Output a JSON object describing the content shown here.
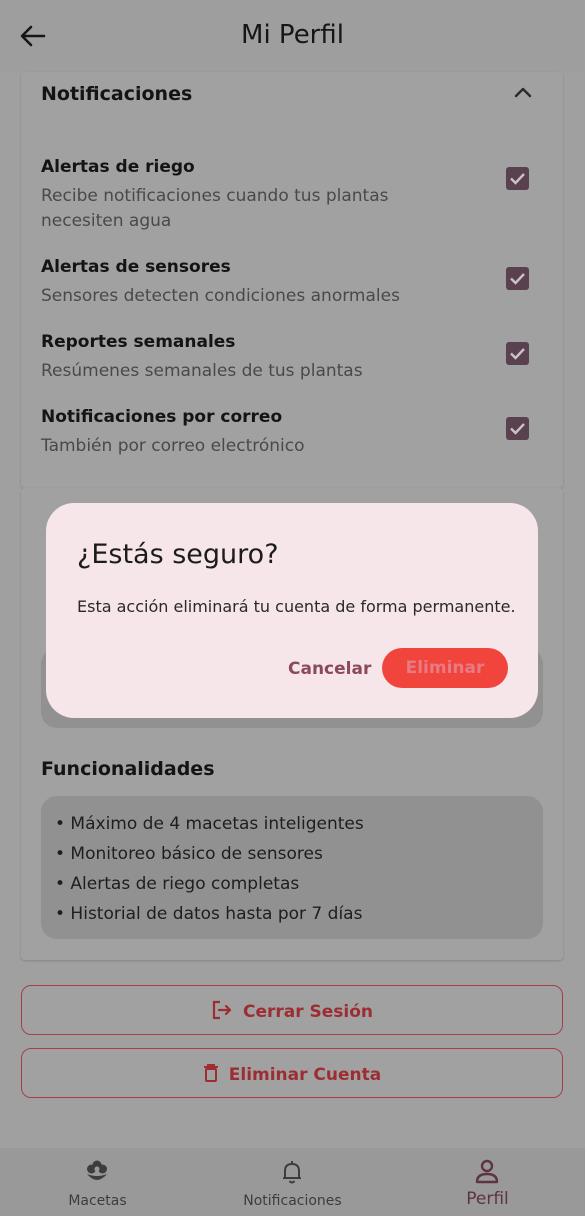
{
  "app_bar": {
    "title": "Mi Perfil"
  },
  "notifications": {
    "title": "Notificaciones",
    "items": [
      {
        "title": "Alertas de riego",
        "subtitle": "Recibe notificaciones cuando tus plantas necesiten agua",
        "checked": true
      },
      {
        "title": "Alertas de sensores",
        "subtitle": "Sensores detecten condiciones anormales",
        "checked": true
      },
      {
        "title": "Reportes semanales",
        "subtitle": "Resúmenes semanales de tus plantas",
        "checked": true
      },
      {
        "title": "Notificaciones por correo",
        "subtitle": "También por correo electrónico",
        "checked": true
      }
    ]
  },
  "plan": {
    "features_title": "Funcionalidades",
    "features": [
      "• Máximo de 4 macetas inteligentes",
      "• Monitoreo básico de sensores",
      "• Alertas de riego completas",
      "• Historial de datos hasta por 7 días"
    ]
  },
  "actions": {
    "logout_label": "Cerrar Sesión",
    "delete_account_label": "Eliminar Cuenta"
  },
  "bottom_nav": {
    "items": [
      {
        "label": "Macetas",
        "icon": "plant-icon",
        "active": false
      },
      {
        "label": "Notificaciones",
        "icon": "bell-icon",
        "active": false
      },
      {
        "label": "Perfil",
        "icon": "person-icon",
        "active": true
      }
    ]
  },
  "dialog": {
    "title": "¿Estás seguro?",
    "body": "Esta acción eliminará tu cuenta de forma permanente.",
    "cancel_label": "Cancelar",
    "confirm_label": "Eliminar"
  },
  "colors": {
    "scrim_bg": "#a1a0a1",
    "dialog_bg": "#f6e6e9",
    "danger": "#f0443c",
    "accent": "#5a4150"
  }
}
